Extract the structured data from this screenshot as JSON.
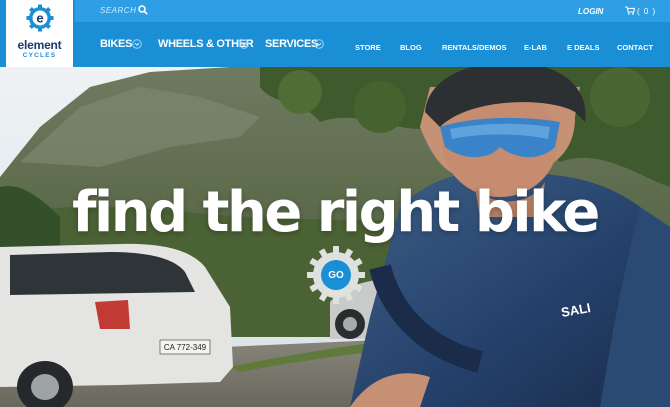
{
  "logo": {
    "name": "element",
    "sub": "CYCLES",
    "mark": "e"
  },
  "topbar": {
    "search_placeholder": "SEARCH",
    "login": "LOGIN",
    "cart_count": "( 0 )"
  },
  "main_nav": [
    {
      "label": "BIKES"
    },
    {
      "label": "WHEELS & OTHER"
    },
    {
      "label": "SERVICES"
    }
  ],
  "secondary_nav": [
    {
      "label": "STORE"
    },
    {
      "label": "BLOG"
    },
    {
      "label": "RENTALS/DEMOS"
    },
    {
      "label": "E-LAB"
    },
    {
      "label": "E DEALS"
    },
    {
      "label": "CONTACT"
    }
  ],
  "hero": {
    "headline": "find the right bike",
    "cta": "GO",
    "jersey_text": "SALI",
    "plate_text": "CA 772-349"
  },
  "colors": {
    "brand_blue": "#1b8fd6",
    "topbar_blue": "#2e9fe4",
    "logo_navy": "#1b3a73"
  },
  "icons": {
    "search": "search-icon",
    "cart": "cart-icon",
    "dropdown": "chevron-down-icon"
  }
}
